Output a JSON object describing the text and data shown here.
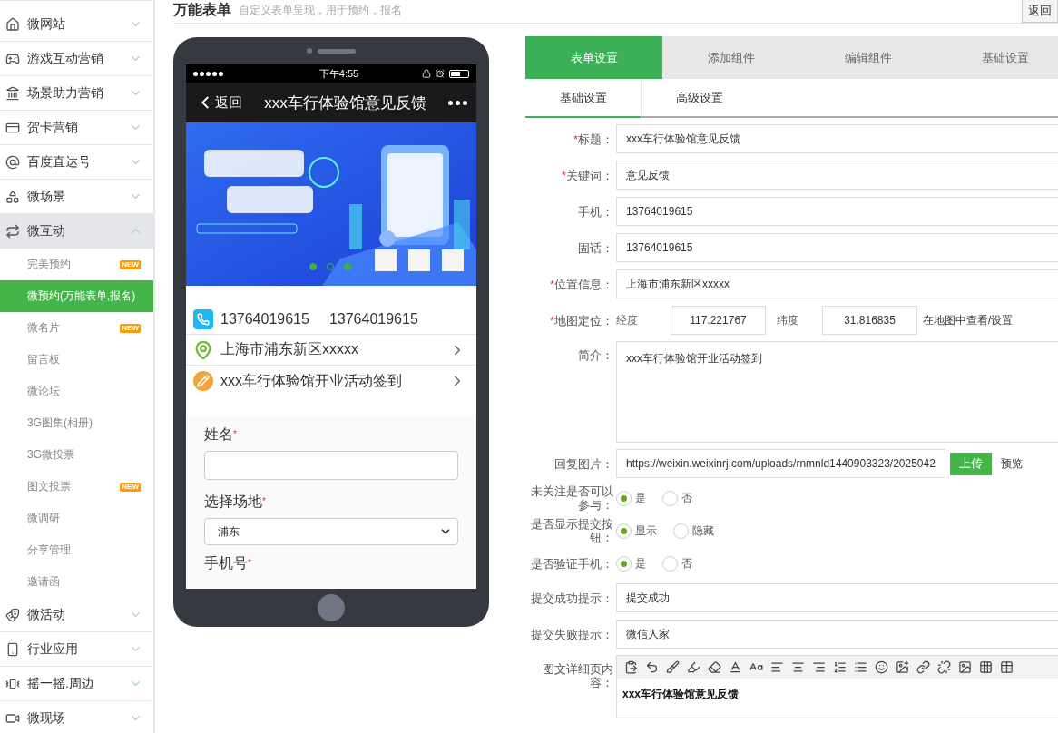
{
  "sidebar": {
    "items": [
      {
        "label": "微网站",
        "expanded": false
      },
      {
        "label": "游戏互动营销",
        "expanded": false
      },
      {
        "label": "场景助力营销",
        "expanded": false
      },
      {
        "label": "贺卡营销",
        "expanded": false
      },
      {
        "label": "百度直达号",
        "expanded": false
      },
      {
        "label": "微场景",
        "expanded": false
      },
      {
        "label": "微互动",
        "expanded": true,
        "children": [
          {
            "label": "完美预约",
            "selected": false,
            "badge": "NEW"
          },
          {
            "label": "微预约(万能表单,报名)",
            "selected": true
          },
          {
            "label": "微名片",
            "selected": false,
            "badge": "NEW"
          },
          {
            "label": "留言板",
            "selected": false
          },
          {
            "label": "微论坛",
            "selected": false
          },
          {
            "label": "3G图集(相册)",
            "selected": false
          },
          {
            "label": "3G微投票",
            "selected": false
          },
          {
            "label": "图文投票",
            "selected": false,
            "badge": "NEW"
          },
          {
            "label": "微调研",
            "selected": false
          },
          {
            "label": "分享管理",
            "selected": false
          },
          {
            "label": "邀请函",
            "selected": false
          }
        ]
      },
      {
        "label": "微活动",
        "expanded": false
      },
      {
        "label": "行业应用",
        "expanded": false
      },
      {
        "label": "摇一摇.周边",
        "expanded": false
      },
      {
        "label": "微现场",
        "expanded": false
      }
    ]
  },
  "header": {
    "title": "万能表单",
    "subtitle": "自定义表单呈现，用于预约，报名",
    "back_button": "返回"
  },
  "phone": {
    "status_time": "下午4:55",
    "back_label": "返回",
    "title": "xxx车行体验馆意见反馈",
    "banner": {
      "kind": "picture",
      "dots": [
        {
          "filled": true
        },
        {
          "filled": false
        },
        {
          "filled": true
        }
      ]
    },
    "contacts": [
      {
        "kind": "phone",
        "text": "13764019615",
        "text_2": "13764019615",
        "chevron": false
      },
      {
        "kind": "location",
        "text": "上海市浦东新区xxxxx",
        "chevron": true
      },
      {
        "kind": "note",
        "text": "xxx车行体验馆开业活动签到",
        "chevron": true
      }
    ],
    "form_fields": [
      {
        "kind": "input",
        "label": "姓名",
        "required_mark": "*"
      },
      {
        "kind": "select",
        "label": "选择场地",
        "required_mark": "*",
        "value": "浦东"
      },
      {
        "kind": "label",
        "label": "手机号",
        "required_mark": "*"
      }
    ]
  },
  "settings": {
    "tabs": [
      {
        "label": "表单设置",
        "selected": true
      },
      {
        "label": "添加组件",
        "selected": false
      },
      {
        "label": "编辑组件",
        "selected": false
      },
      {
        "label": "基础设置",
        "selected": false
      }
    ],
    "subtabs": [
      {
        "label": "基础设置",
        "selected": true
      },
      {
        "label": "高级设置",
        "selected": false
      }
    ],
    "rows": [
      {
        "kind": "text",
        "label": "标题：",
        "required_mark": "*",
        "value": "xxx车行体验馆意见反馈"
      },
      {
        "kind": "text",
        "label": "关键词：",
        "required_mark": "*",
        "value": "意见反馈"
      },
      {
        "kind": "text",
        "label": "手机：",
        "value": "13764019615"
      },
      {
        "kind": "text",
        "label": "固话：",
        "value": "13764019615"
      },
      {
        "kind": "text",
        "label": "位置信息：",
        "required_mark": "*",
        "value": "上海市浦东新区xxxxx"
      },
      {
        "kind": "geo",
        "label": "地图定位：",
        "required_mark": "*",
        "lng_label": "经度",
        "lng": "117.221767",
        "lat_label": "纬度",
        "lat": "31.816835",
        "link": "在地图中查看/设置"
      },
      {
        "kind": "textarea",
        "label": "简介：",
        "value": "xxx车行体验馆开业活动签到"
      },
      {
        "kind": "upload",
        "label": "回复图片：",
        "value": "https://weixin.weixinrj.com/uploads/rnmnld1440903323/2025042",
        "button": "上传",
        "link": "预览"
      },
      {
        "kind": "radio",
        "label": "未关注是否可以参与：",
        "options": [
          {
            "label": "是",
            "selected": true
          },
          {
            "label": "否",
            "selected": false
          }
        ]
      },
      {
        "kind": "radio",
        "label": "是否显示提交按钮：",
        "options": [
          {
            "label": "显示",
            "selected": true
          },
          {
            "label": "隐藏",
            "selected": false
          }
        ]
      },
      {
        "kind": "radio",
        "label": "是否验证手机：",
        "options": [
          {
            "label": "是",
            "selected": true
          },
          {
            "label": "否",
            "selected": false
          }
        ]
      },
      {
        "kind": "text",
        "label": "提交成功提示：",
        "value": "提交成功"
      },
      {
        "kind": "text",
        "label": "提交失败提示：",
        "value": "微信人家"
      },
      {
        "kind": "editor",
        "label": "图文详细页内容：",
        "content": "xxx车行体验馆意见反馈"
      }
    ]
  }
}
